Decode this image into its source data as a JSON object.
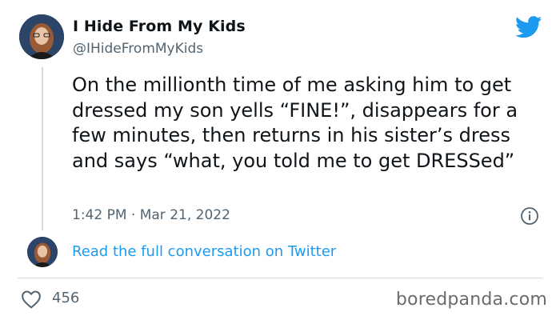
{
  "tweet": {
    "author": {
      "display_name": "I Hide From My Kids",
      "handle": "@IHideFromMyKids"
    },
    "text": "On the millionth time of me asking him to get dressed my son yells “FINE!”, disappears for a few minutes, then returns in his sister’s dress and says “what, you told me to get DRESSed”",
    "time": "1:42 PM",
    "separator": "·",
    "date": "Mar 21, 2022",
    "thread_link_label": "Read the full conversation on Twitter",
    "likes": "456"
  },
  "icons": {
    "brand": "twitter-bird-icon",
    "info": "info-icon",
    "like": "heart-icon"
  },
  "colors": {
    "link": "#1d9bf0",
    "twitter_brand": "#1d9bf0",
    "secondary_text": "#536471"
  },
  "watermark": "boredpanda.com"
}
